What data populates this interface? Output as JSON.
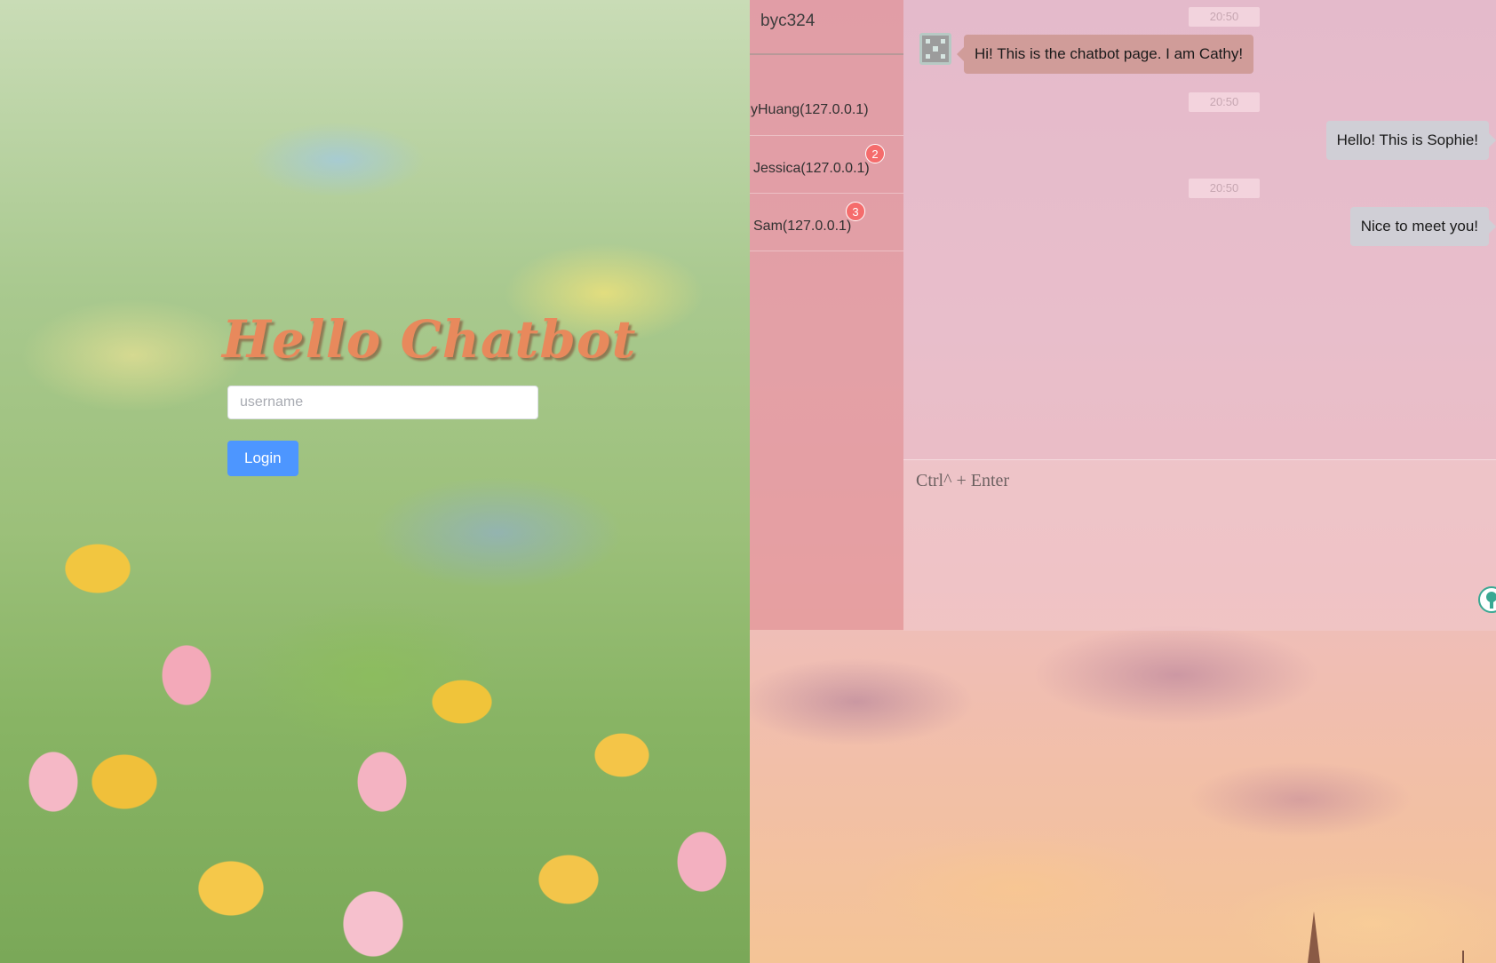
{
  "login": {
    "title": "Hello Chatbot",
    "username_placeholder": "username",
    "username_value": "",
    "login_label": "Login"
  },
  "chat": {
    "current_user": "byc324",
    "contacts": [
      {
        "label": "yHuang(127.0.0.1)",
        "badge": ""
      },
      {
        "label": "Jessica(127.0.0.1)",
        "badge": "2"
      },
      {
        "label": "Sam(127.0.0.1)",
        "badge": "3"
      }
    ],
    "messages": [
      {
        "time": "20:50",
        "text": "Hi! This is the chatbot page. I am Cathy!",
        "direction": "in"
      },
      {
        "time": "20:50",
        "text": "Hello! This is Sophie!",
        "direction": "out"
      },
      {
        "time": "20:50",
        "text": "Nice to meet you!",
        "direction": "out"
      }
    ],
    "input_placeholder": "Ctrl^ + Enter",
    "input_value": ""
  },
  "icons": {
    "bot_avatar": "robot-avatar-icon",
    "send": "lightbulb-send-icon"
  },
  "colors": {
    "login_button": "#4d96ff",
    "title": "#e8895c",
    "badge": "#f56c6c"
  }
}
